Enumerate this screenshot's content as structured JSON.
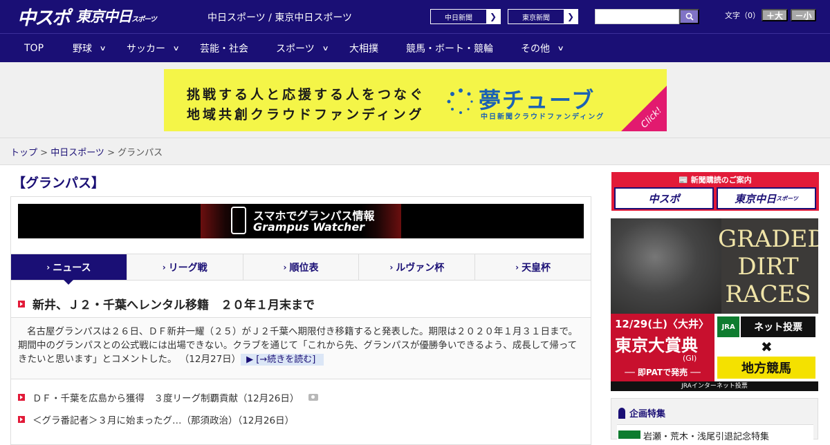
{
  "header": {
    "logo_main": "中スポ",
    "logo_tokyo": "東京中日",
    "logo_tokyo_small": "スポーツ",
    "site_links": "中日スポーツ / 東京中日スポーツ",
    "btn_chunichi": "中日新聞",
    "btn_tokyo": "東京新聞",
    "search_placeholder": "",
    "fontsize_label": "文字（0）",
    "fontsize_plus": "＋大",
    "fontsize_minus": "－小"
  },
  "nav": {
    "items": [
      {
        "label": "TOP"
      },
      {
        "label": "野球"
      },
      {
        "label": "サッカー"
      },
      {
        "label": "芸能・社会"
      },
      {
        "label": "スポーツ"
      },
      {
        "label": "大相撲"
      },
      {
        "label": "競馬・ボート・競輪"
      },
      {
        "label": "その他"
      }
    ]
  },
  "ad_banner": {
    "line1": "挑戦する人と応援する人をつなぐ",
    "line2": "地域共創クラウドファンディング",
    "brand": "夢チューブ",
    "brand_sub": "中日新聞クラウドファンディング",
    "click": "Click!"
  },
  "breadcrumb": {
    "top": "トップ",
    "sep1": " > ",
    "section": "中日スポーツ",
    "sep2": " > ",
    "current": "グランパス"
  },
  "page_title": "【グランパス】",
  "grampus_banner": {
    "line1": "スマホでグランパス情報",
    "line2": "Grampus Watcher"
  },
  "tabs": [
    {
      "label": "ニュース"
    },
    {
      "label": "リーグ戦"
    },
    {
      "label": "順位表"
    },
    {
      "label": "ルヴァン杯"
    },
    {
      "label": "天皇杯"
    }
  ],
  "article": {
    "headline": "新井、Ｊ２・千葉へレンタル移籍　２０年１月末まで",
    "lead": "名古屋グランパスは２６日、ＤＦ新井一耀（２５）がＪ２千葉へ期限付き移籍すると発表した。期限は２０２０年１月３１日まで。期間中のグランパスとの公式戦には出場できない。クラブを通じて「これから先、グランパスが優勝争いできるよう、成長して帰ってきたいと思います」とコメントした。",
    "date": "（12月27日）",
    "read_more": "[→続きを読む]"
  },
  "news_list": [
    {
      "text": "ＤＦ・千葉を広島から獲得　３度リーグ制覇貢献（12月26日）"
    },
    {
      "text": "＜グラ番記者＞３月に始まったグ…（那須政治）（12月26日）"
    }
  ],
  "sidebar": {
    "subscribe_head": "新聞購読のご案内",
    "subscribe_chuspo": "中スポ",
    "subscribe_tokyo": "東京中日",
    "subscribe_tokyo_small": "スポーツ",
    "race_title_line1": "GRADED",
    "race_title_line2": "DIRT",
    "race_title_line3": "RACES",
    "race_date": "12/29(土)〈大井〉",
    "race_name": "東京大賞典",
    "race_grade": "(GI)",
    "race_pat": "── 即PATで発売 ──",
    "jra": "JRA",
    "net": "ネット投票",
    "chiho": "地方競馬",
    "race_footer": "JRAインターネット投票",
    "special_head": "企画特集",
    "special_item": "岩瀬・荒木・浅尾引退記念特集"
  },
  "colors": {
    "brand_navy": "#1a0f75",
    "accent_red": "#e21a38",
    "banner_yellow": "#f4f548",
    "banner_blue": "#1b62b4"
  }
}
